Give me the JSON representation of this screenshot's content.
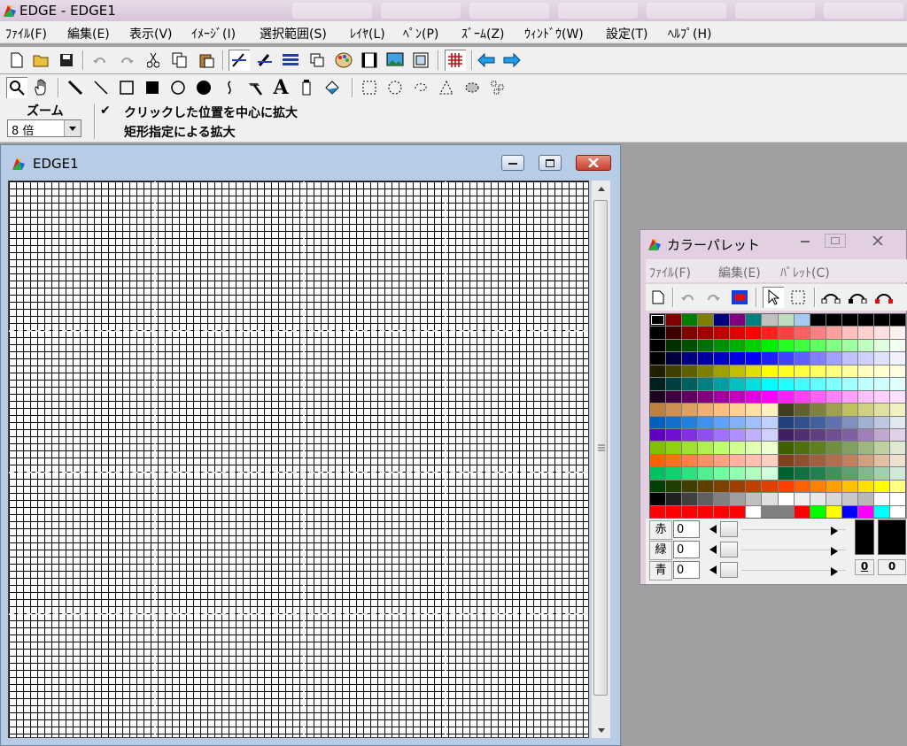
{
  "app": {
    "title": "EDGE - EDGE1"
  },
  "menubar": [
    "ﾌｧｲﾙ(F)",
    "編集(E)",
    "表示(V)",
    "ｲﾒｰｼﾞ(I)",
    "選択範囲(S)",
    "ﾚｲﾔ(L)",
    "ﾍﾟﾝ(P)",
    "ｽﾞｰﾑ(Z)",
    "ｳｨﾝﾄﾞｳ(W)",
    "設定(T)",
    "ﾍﾙﾌﾟ(H)"
  ],
  "zoom_panel": {
    "label": "ズーム",
    "value": "8 倍",
    "option1": "クリックした位置を中心に拡大",
    "option1_checked": "✔",
    "option2": "矩形指定による拡大"
  },
  "doc_window": {
    "title": "EDGE1"
  },
  "palette_window": {
    "title": "カラーパレット",
    "menu": [
      "ﾌｧｲﾙ(F)",
      "編集(E)",
      "ﾊﾟﾚｯﾄ(C)"
    ],
    "labels": {
      "red": "赤",
      "green": "緑",
      "blue": "青"
    },
    "values": {
      "red": "0",
      "green": "0",
      "blue": "0"
    },
    "index_fg": "0",
    "index_bg": "0"
  },
  "colors": {
    "accent_red": "#c8402e",
    "palette_rows": [
      [
        "#000000",
        "#800000",
        "#008000",
        "#808000",
        "#000080",
        "#800080",
        "#008080",
        "#c0c0c0",
        "#c0dcc0",
        "#a6caf0",
        "#000000",
        "#000000",
        "#000000",
        "#000000",
        "#000000",
        "#000000"
      ],
      [
        "#000000",
        "#400000",
        "#800000",
        "#a00000",
        "#c00000",
        "#e00000",
        "#ff0000",
        "#ff2020",
        "#ff4040",
        "#ff6060",
        "#ff8080",
        "#ffa0a0",
        "#ffc0c0",
        "#ffd0d0",
        "#ffe0e0",
        "#fff0f0"
      ],
      [
        "#000000",
        "#003000",
        "#005000",
        "#007000",
        "#009000",
        "#00b000",
        "#00d000",
        "#00f000",
        "#20ff20",
        "#40ff40",
        "#60ff60",
        "#80ff80",
        "#a0ffa0",
        "#c0ffc0",
        "#e0ffe0",
        "#f0fff0"
      ],
      [
        "#000000",
        "#000040",
        "#000080",
        "#0000a0",
        "#0000c0",
        "#0000e0",
        "#0000ff",
        "#2020ff",
        "#4040ff",
        "#6060ff",
        "#8080ff",
        "#a0a0ff",
        "#c0c0ff",
        "#d0d0ff",
        "#e0e0ff",
        "#f0f0ff"
      ],
      [
        "#202000",
        "#404000",
        "#606000",
        "#808000",
        "#a0a000",
        "#c0c000",
        "#e0e000",
        "#ffff00",
        "#ffff20",
        "#ffff40",
        "#ffff60",
        "#ffff80",
        "#ffffa0",
        "#ffffc0",
        "#ffffd0",
        "#ffffe0"
      ],
      [
        "#002020",
        "#004040",
        "#006060",
        "#008080",
        "#00a0a0",
        "#00c0c0",
        "#00e0e0",
        "#00ffff",
        "#20ffff",
        "#40ffff",
        "#60ffff",
        "#80ffff",
        "#a0ffff",
        "#c0ffff",
        "#d0ffff",
        "#e0ffff"
      ],
      [
        "#200020",
        "#400040",
        "#600060",
        "#800080",
        "#a000a0",
        "#c000c0",
        "#e000e0",
        "#ff00ff",
        "#ff20ff",
        "#ff40ff",
        "#ff60ff",
        "#ff80ff",
        "#ffa0ff",
        "#ffc0ff",
        "#ffd0ff",
        "#ffe0ff"
      ],
      [
        "#c08040",
        "#d09050",
        "#e0a060",
        "#f0b070",
        "#ffc080",
        "#ffd090",
        "#ffe0a0",
        "#fff0c0",
        "#404020",
        "#606030",
        "#808040",
        "#a0a050",
        "#c0c060",
        "#d0d080",
        "#e0e0a0",
        "#f0f0c0"
      ],
      [
        "#0060c0",
        "#1070d0",
        "#2080e0",
        "#4090f0",
        "#60a0ff",
        "#80b0ff",
        "#a0c0ff",
        "#c0d0ff",
        "#204080",
        "#305090",
        "#4060a0",
        "#6070b0",
        "#8090c0",
        "#a0b0d0",
        "#c0c8e0",
        "#e0e8f0"
      ],
      [
        "#6000c0",
        "#7010d0",
        "#8030e0",
        "#9050f0",
        "#a070ff",
        "#b090ff",
        "#c0b0ff",
        "#d0d0ff",
        "#402060",
        "#503070",
        "#604080",
        "#705090",
        "#8060a0",
        "#a080b8",
        "#c0a8d0",
        "#e0d0e8"
      ],
      [
        "#80c000",
        "#90d010",
        "#a0e030",
        "#b0f050",
        "#c0ff70",
        "#d0ff90",
        "#e0ffb0",
        "#f0ffd0",
        "#406000",
        "#507010",
        "#608020",
        "#709040",
        "#80a060",
        "#a0b880",
        "#c0d0a0",
        "#e0e8d0"
      ],
      [
        "#ff6000",
        "#ff7020",
        "#ff8040",
        "#ff9060",
        "#ffa080",
        "#ffb0a0",
        "#ffc0b0",
        "#ffd0c0",
        "#804020",
        "#905030",
        "#a06040",
        "#b07050",
        "#c08060",
        "#d0a080",
        "#e0c0a0",
        "#f0e0d0"
      ],
      [
        "#00c060",
        "#10d070",
        "#30e080",
        "#50f090",
        "#70ffa0",
        "#90ffb0",
        "#b0ffc0",
        "#d0ffe0",
        "#006030",
        "#107040",
        "#208050",
        "#409060",
        "#60a070",
        "#80b890",
        "#a0d0b0",
        "#d0e8d8"
      ],
      [
        "#004000",
        "#204000",
        "#404000",
        "#604000",
        "#804000",
        "#a04000",
        "#c04000",
        "#e04000",
        "#ff4000",
        "#ff6000",
        "#ff8000",
        "#ffa000",
        "#ffc000",
        "#ffe000",
        "#ffff00",
        "#ffff80"
      ],
      [
        "#000000",
        "#202020",
        "#404040",
        "#606060",
        "#808080",
        "#a0a0a0",
        "#c0c0c0",
        "#e0e0e0",
        "#ffffff",
        "#f0f0f0",
        "#e8e8e8",
        "#d8d8d8",
        "#c8c8c8",
        "#b8b8b8",
        "#f8f8f8",
        "#ffffff"
      ],
      [
        "#ff0000",
        "#ff0000",
        "#ff0000",
        "#ff0000",
        "#ff0000",
        "#ff0000",
        "#ffffff",
        "#808080",
        "#808080",
        "#ff0000",
        "#00ff00",
        "#ffff00",
        "#0000ff",
        "#ff00ff",
        "#00ffff",
        "#ffffff"
      ]
    ]
  },
  "icons": [
    "new-icon",
    "open-icon",
    "save-icon",
    "undo-icon",
    "redo-icon",
    "cut-icon",
    "copy-icon",
    "paste-icon",
    "pen-icon",
    "brush-icon",
    "grid-icon",
    "zoom-icon",
    "hand-icon",
    "line-icon",
    "rect-icon",
    "ellipse-icon",
    "text-icon",
    "fill-icon",
    "select-rect-icon",
    "lasso-icon"
  ]
}
